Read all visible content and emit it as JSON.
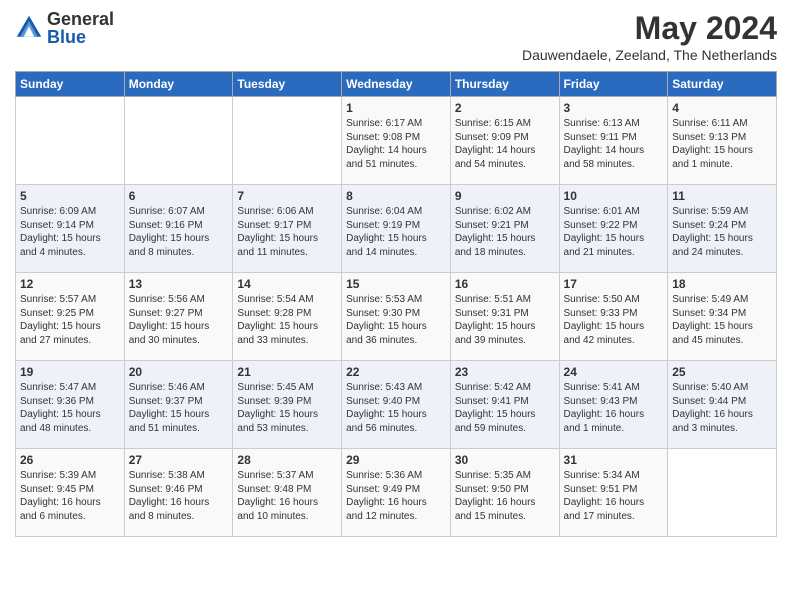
{
  "header": {
    "logo_general": "General",
    "logo_blue": "Blue",
    "month_title": "May 2024",
    "subtitle": "Dauwendaele, Zeeland, The Netherlands"
  },
  "days_of_week": [
    "Sunday",
    "Monday",
    "Tuesday",
    "Wednesday",
    "Thursday",
    "Friday",
    "Saturday"
  ],
  "weeks": [
    [
      {
        "day": "",
        "info": ""
      },
      {
        "day": "",
        "info": ""
      },
      {
        "day": "",
        "info": ""
      },
      {
        "day": "1",
        "info": "Sunrise: 6:17 AM\nSunset: 9:08 PM\nDaylight: 14 hours\nand 51 minutes."
      },
      {
        "day": "2",
        "info": "Sunrise: 6:15 AM\nSunset: 9:09 PM\nDaylight: 14 hours\nand 54 minutes."
      },
      {
        "day": "3",
        "info": "Sunrise: 6:13 AM\nSunset: 9:11 PM\nDaylight: 14 hours\nand 58 minutes."
      },
      {
        "day": "4",
        "info": "Sunrise: 6:11 AM\nSunset: 9:13 PM\nDaylight: 15 hours\nand 1 minute."
      }
    ],
    [
      {
        "day": "5",
        "info": "Sunrise: 6:09 AM\nSunset: 9:14 PM\nDaylight: 15 hours\nand 4 minutes."
      },
      {
        "day": "6",
        "info": "Sunrise: 6:07 AM\nSunset: 9:16 PM\nDaylight: 15 hours\nand 8 minutes."
      },
      {
        "day": "7",
        "info": "Sunrise: 6:06 AM\nSunset: 9:17 PM\nDaylight: 15 hours\nand 11 minutes."
      },
      {
        "day": "8",
        "info": "Sunrise: 6:04 AM\nSunset: 9:19 PM\nDaylight: 15 hours\nand 14 minutes."
      },
      {
        "day": "9",
        "info": "Sunrise: 6:02 AM\nSunset: 9:21 PM\nDaylight: 15 hours\nand 18 minutes."
      },
      {
        "day": "10",
        "info": "Sunrise: 6:01 AM\nSunset: 9:22 PM\nDaylight: 15 hours\nand 21 minutes."
      },
      {
        "day": "11",
        "info": "Sunrise: 5:59 AM\nSunset: 9:24 PM\nDaylight: 15 hours\nand 24 minutes."
      }
    ],
    [
      {
        "day": "12",
        "info": "Sunrise: 5:57 AM\nSunset: 9:25 PM\nDaylight: 15 hours\nand 27 minutes."
      },
      {
        "day": "13",
        "info": "Sunrise: 5:56 AM\nSunset: 9:27 PM\nDaylight: 15 hours\nand 30 minutes."
      },
      {
        "day": "14",
        "info": "Sunrise: 5:54 AM\nSunset: 9:28 PM\nDaylight: 15 hours\nand 33 minutes."
      },
      {
        "day": "15",
        "info": "Sunrise: 5:53 AM\nSunset: 9:30 PM\nDaylight: 15 hours\nand 36 minutes."
      },
      {
        "day": "16",
        "info": "Sunrise: 5:51 AM\nSunset: 9:31 PM\nDaylight: 15 hours\nand 39 minutes."
      },
      {
        "day": "17",
        "info": "Sunrise: 5:50 AM\nSunset: 9:33 PM\nDaylight: 15 hours\nand 42 minutes."
      },
      {
        "day": "18",
        "info": "Sunrise: 5:49 AM\nSunset: 9:34 PM\nDaylight: 15 hours\nand 45 minutes."
      }
    ],
    [
      {
        "day": "19",
        "info": "Sunrise: 5:47 AM\nSunset: 9:36 PM\nDaylight: 15 hours\nand 48 minutes."
      },
      {
        "day": "20",
        "info": "Sunrise: 5:46 AM\nSunset: 9:37 PM\nDaylight: 15 hours\nand 51 minutes."
      },
      {
        "day": "21",
        "info": "Sunrise: 5:45 AM\nSunset: 9:39 PM\nDaylight: 15 hours\nand 53 minutes."
      },
      {
        "day": "22",
        "info": "Sunrise: 5:43 AM\nSunset: 9:40 PM\nDaylight: 15 hours\nand 56 minutes."
      },
      {
        "day": "23",
        "info": "Sunrise: 5:42 AM\nSunset: 9:41 PM\nDaylight: 15 hours\nand 59 minutes."
      },
      {
        "day": "24",
        "info": "Sunrise: 5:41 AM\nSunset: 9:43 PM\nDaylight: 16 hours\nand 1 minute."
      },
      {
        "day": "25",
        "info": "Sunrise: 5:40 AM\nSunset: 9:44 PM\nDaylight: 16 hours\nand 3 minutes."
      }
    ],
    [
      {
        "day": "26",
        "info": "Sunrise: 5:39 AM\nSunset: 9:45 PM\nDaylight: 16 hours\nand 6 minutes."
      },
      {
        "day": "27",
        "info": "Sunrise: 5:38 AM\nSunset: 9:46 PM\nDaylight: 16 hours\nand 8 minutes."
      },
      {
        "day": "28",
        "info": "Sunrise: 5:37 AM\nSunset: 9:48 PM\nDaylight: 16 hours\nand 10 minutes."
      },
      {
        "day": "29",
        "info": "Sunrise: 5:36 AM\nSunset: 9:49 PM\nDaylight: 16 hours\nand 12 minutes."
      },
      {
        "day": "30",
        "info": "Sunrise: 5:35 AM\nSunset: 9:50 PM\nDaylight: 16 hours\nand 15 minutes."
      },
      {
        "day": "31",
        "info": "Sunrise: 5:34 AM\nSunset: 9:51 PM\nDaylight: 16 hours\nand 17 minutes."
      },
      {
        "day": "",
        "info": ""
      }
    ]
  ]
}
